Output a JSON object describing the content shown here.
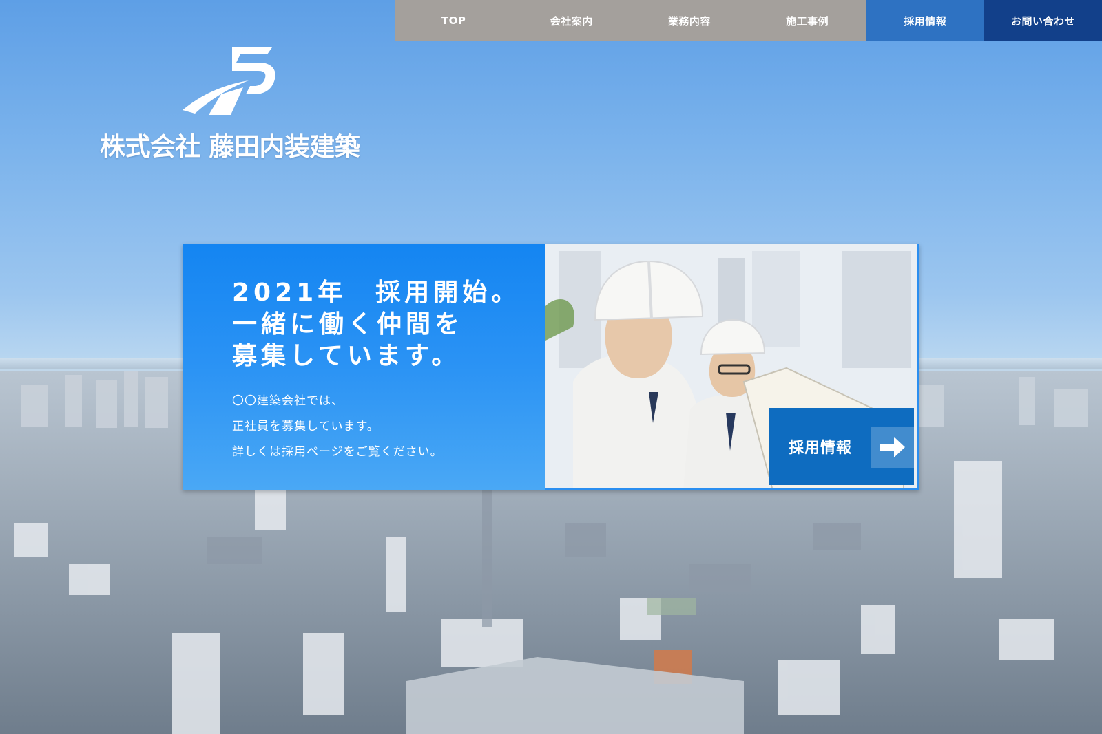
{
  "nav": {
    "items": [
      {
        "label": "TOP"
      },
      {
        "label": "会社案内"
      },
      {
        "label": "業務内容"
      },
      {
        "label": "施工事例"
      },
      {
        "label": "採用情報"
      },
      {
        "label": "お問い合わせ"
      }
    ]
  },
  "logo": {
    "company_name": "株式会社 藤田内装建築"
  },
  "banner": {
    "headline": [
      "2021年　採用開始。",
      "一緒に働く仲間を",
      "募集しています。"
    ],
    "body": [
      "〇〇建築会社では、",
      "正社員を募集しています。",
      "詳しくは採用ページをご覧ください。"
    ],
    "cta_label": "採用情報",
    "cta_icon": "arrow-right-icon"
  },
  "colors": {
    "nav_gray": "#a4a09c",
    "nav_recruit": "#2e72c2",
    "nav_contact": "#12408a",
    "banner_blue": "#1485f2",
    "cta_blue": "#0e6cc0"
  }
}
